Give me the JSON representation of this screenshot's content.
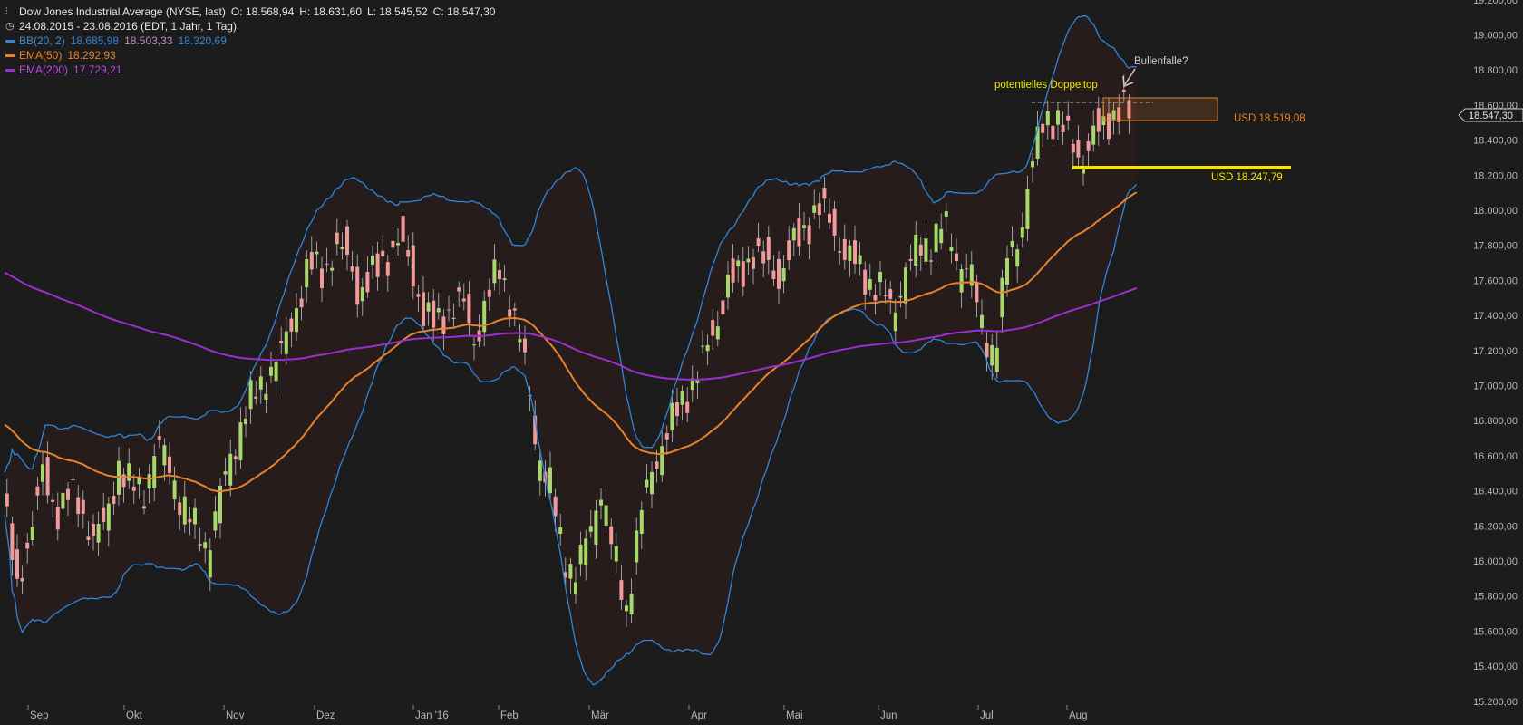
{
  "header": {
    "title": "Dow Jones Industrial Average (NYSE, last)",
    "ohlc": {
      "o": "O: 18.568,94",
      "h": "H: 18.631,60",
      "l": "L: 18.545,52",
      "c": "C: 18.547,30"
    },
    "range": "24.08.2015 - 23.08.2016 (EDT, 1 Jahr, 1 Tag)"
  },
  "legend": {
    "bb": {
      "label": "BB(20, 2)",
      "v1": "18.685,98",
      "v2": "18.503,33",
      "v3": "18.320,69",
      "color": "#2f86d9"
    },
    "ema50": {
      "label": "EMA(50)",
      "value": "18.292,93",
      "color": "#e8822b"
    },
    "ema200": {
      "label": "EMA(200)",
      "value": "17.729,21",
      "color": "#9b2fd0"
    }
  },
  "annotations": {
    "doubletop": "potentielles Doppeltop",
    "bullfalle": "Bullenfalle?",
    "level1": "USD 18.519,08",
    "level2": "USD 18.247,79",
    "last_price": "18.547,30"
  },
  "colors": {
    "up": "#a6d96a",
    "down": "#f19a9a",
    "bb": "#2f86d9",
    "ema50": "#e8822b",
    "ema200": "#9b2fd0",
    "yellow": "#f2e600",
    "box": "#e8822b"
  },
  "chart_data": {
    "type": "line",
    "series": [
      {
        "name": "Dow Jones Industrial Average (NYSE, last)",
        "values": [
          [
            0,
            16350
          ],
          [
            5,
            15850
          ],
          [
            10,
            16200
          ],
          [
            15,
            16500
          ],
          [
            20,
            16300
          ],
          [
            25,
            16400
          ],
          [
            30,
            16300
          ],
          [
            35,
            16150
          ],
          [
            40,
            16200
          ],
          [
            45,
            16550
          ],
          [
            50,
            16400
          ],
          [
            55,
            16380
          ],
          [
            60,
            16650
          ],
          [
            65,
            16500
          ],
          [
            70,
            16300
          ],
          [
            75,
            16150
          ],
          [
            80,
            16050
          ],
          [
            85,
            16350
          ],
          [
            90,
            16600
          ],
          [
            95,
            16850
          ],
          [
            100,
            16950
          ],
          [
            105,
            17100
          ],
          [
            110,
            17200
          ],
          [
            115,
            17450
          ],
          [
            120,
            17700
          ],
          [
            125,
            17650
          ],
          [
            130,
            17800
          ],
          [
            135,
            17750
          ],
          [
            140,
            17550
          ],
          [
            145,
            17650
          ],
          [
            150,
            17750
          ],
          [
            155,
            17850
          ],
          [
            160,
            17700
          ],
          [
            165,
            17450
          ],
          [
            170,
            17350
          ],
          [
            175,
            17450
          ],
          [
            180,
            17500
          ],
          [
            185,
            17250
          ],
          [
            190,
            17500
          ],
          [
            195,
            17650
          ],
          [
            200,
            17450
          ],
          [
            205,
            17100
          ],
          [
            210,
            16600
          ],
          [
            215,
            16400
          ],
          [
            220,
            16000
          ],
          [
            225,
            15900
          ],
          [
            230,
            16100
          ],
          [
            235,
            16400
          ],
          [
            240,
            16000
          ],
          [
            245,
            15700
          ],
          [
            250,
            16200
          ],
          [
            255,
            16500
          ],
          [
            260,
            16700
          ],
          [
            265,
            16850
          ],
          [
            270,
            17000
          ],
          [
            275,
            17150
          ],
          [
            280,
            17350
          ],
          [
            285,
            17600
          ],
          [
            290,
            17650
          ],
          [
            295,
            17800
          ],
          [
            300,
            17700
          ],
          [
            305,
            17650
          ],
          [
            310,
            17800
          ],
          [
            315,
            17900
          ],
          [
            320,
            18050
          ],
          [
            325,
            17950
          ],
          [
            330,
            17800
          ],
          [
            335,
            17700
          ],
          [
            340,
            17600
          ],
          [
            345,
            17550
          ],
          [
            350,
            17400
          ],
          [
            355,
            17650
          ],
          [
            360,
            17750
          ],
          [
            365,
            17800
          ],
          [
            370,
            17900
          ],
          [
            375,
            17700
          ],
          [
            380,
            17650
          ],
          [
            385,
            17300
          ],
          [
            390,
            17150
          ],
          [
            395,
            17700
          ],
          [
            400,
            17850
          ],
          [
            405,
            18250
          ],
          [
            410,
            18550
          ],
          [
            415,
            18500
          ],
          [
            420,
            18400
          ],
          [
            425,
            18300
          ],
          [
            430,
            18450
          ],
          [
            435,
            18550
          ],
          [
            440,
            18600
          ],
          [
            445,
            18550
          ]
        ]
      },
      {
        "name": "BB(20, 2)",
        "values": []
      },
      {
        "name": "EMA(50)",
        "values": []
      },
      {
        "name": "EMA(200)",
        "values": []
      }
    ],
    "x_ticks": [
      "Sep",
      "Okt",
      "Nov",
      "Dez",
      "Jan '16",
      "Feb",
      "Mär",
      "Apr",
      "Mai",
      "Jun",
      "Jul",
      "Aug"
    ],
    "y_ticks": [
      "15.200,00",
      "15.400,00",
      "15.600,00",
      "15.800,00",
      "16.000,00",
      "16.200,00",
      "16.400,00",
      "16.600,00",
      "16.800,00",
      "17.000,00",
      "17.200,00",
      "17.400,00",
      "17.600,00",
      "17.800,00",
      "18.000,00",
      "18.200,00",
      "18.400,00",
      "18.600,00",
      "18.800,00",
      "19.000,00",
      "19.200,00"
    ],
    "ylim": [
      15150,
      19200
    ],
    "levels": [
      18519.08,
      18247.79
    ],
    "grid": false
  }
}
